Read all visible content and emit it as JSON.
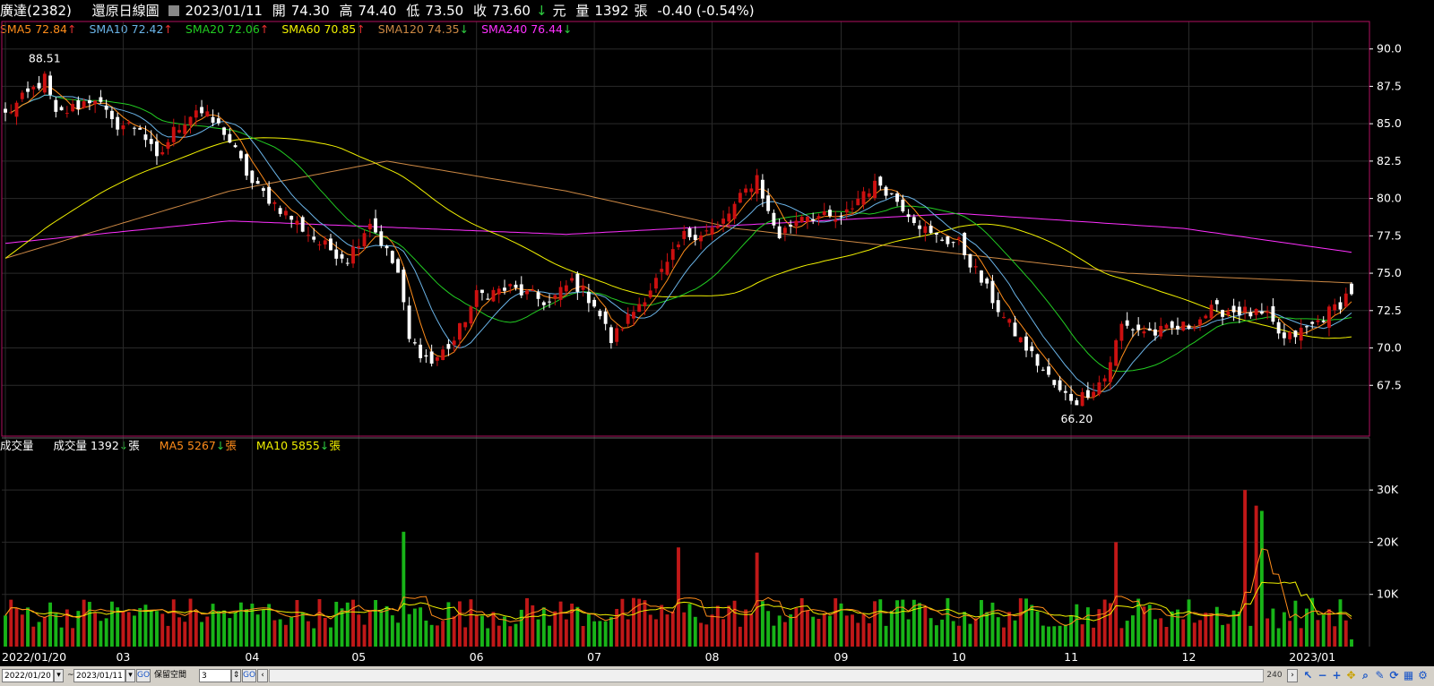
{
  "header": {
    "stock_name": "廣達(2382)",
    "mode": "還原日線圖",
    "date": "2023/01/11",
    "open_label": "開",
    "open": "74.30",
    "high_label": "高",
    "high": "74.40",
    "low_label": "低",
    "low": "73.50",
    "close_label": "收",
    "close": "73.60",
    "currency": "元",
    "volume_label": "量",
    "volume": "1392",
    "volume_unit": "張",
    "change": "-0.40 (-0.54%)"
  },
  "ma_legend": [
    {
      "label": "SMA5 72.84",
      "color": "#ff8c1a",
      "arrow": "↑"
    },
    {
      "label": "SMA10 72.42",
      "color": "#6ab4e8",
      "arrow": "↑"
    },
    {
      "label": "SMA20 72.06",
      "color": "#22cc22",
      "arrow": "↑"
    },
    {
      "label": "SMA60 70.85",
      "color": "#f0f000",
      "arrow": "↑"
    },
    {
      "label": "SMA120 74.35",
      "color": "#cc8844",
      "arrow": "↓"
    },
    {
      "label": "SMA240 76.44",
      "color": "#ff30ff",
      "arrow": "↓"
    }
  ],
  "volume_legend": {
    "title": "成交量",
    "vol": "成交量 1392",
    "vol_unit": "張",
    "vol_arrow": "↓",
    "ma5": "MA5 5267",
    "ma5_unit": "張",
    "ma5_arrow": "↓",
    "ma10": "MA10 5855",
    "ma10_unit": "張",
    "ma10_arrow": "↓"
  },
  "footer": {
    "start_date": "2022/01/20",
    "tilde": "~",
    "end_date": "2023/01/11",
    "go_label": "GO",
    "reserve_label": "保留空間",
    "reserve_value": "3",
    "zoom_value": "240"
  },
  "colors": {
    "up": "#cc1010",
    "down": "#ffffff",
    "vol_up": "#c01818",
    "vol_down": "#18b418",
    "grid": "#2a2a2a",
    "frame": "#b01060",
    "axis_text": "#ffffff"
  },
  "chart_data": {
    "type": "candlestick",
    "price_axis": {
      "ylim": [
        65.0,
        91.0
      ],
      "ticks": [
        67.5,
        70.0,
        72.5,
        75.0,
        77.5,
        80.0,
        82.5,
        85.0,
        87.5,
        90.0
      ]
    },
    "volume_axis": {
      "ylim": [
        0,
        35000
      ],
      "ticks": [
        10000,
        20000,
        30000
      ],
      "tick_labels": [
        "10K",
        "20K",
        "30K"
      ]
    },
    "x_ticks": [
      {
        "label": "2022/01/20",
        "i": 0
      },
      {
        "label": "03",
        "i": 21
      },
      {
        "label": "04",
        "i": 44
      },
      {
        "label": "05",
        "i": 63
      },
      {
        "label": "06",
        "i": 84
      },
      {
        "label": "07",
        "i": 105
      },
      {
        "label": "08",
        "i": 126
      },
      {
        "label": "09",
        "i": 149
      },
      {
        "label": "10",
        "i": 170
      },
      {
        "label": "11",
        "i": 190
      },
      {
        "label": "12",
        "i": 211
      },
      {
        "label": "2023/01",
        "i": 233
      }
    ],
    "annotations": [
      {
        "label": "88.51",
        "i": 7,
        "value": 88.51
      },
      {
        "label": "66.20",
        "i": 191,
        "value": 66.2
      }
    ],
    "anchors": [
      [
        0,
        85.6
      ],
      [
        7,
        88.0
      ],
      [
        9,
        85.5
      ],
      [
        16,
        86.8
      ],
      [
        19,
        85.0
      ],
      [
        24,
        84.8
      ],
      [
        27,
        82.5
      ],
      [
        30,
        84.5
      ],
      [
        34,
        86.0
      ],
      [
        39,
        84.5
      ],
      [
        44,
        81.0
      ],
      [
        50,
        79.0
      ],
      [
        56,
        77.0
      ],
      [
        61,
        76.0
      ],
      [
        65,
        78.5
      ],
      [
        70,
        75.0
      ],
      [
        72,
        70.5
      ],
      [
        76,
        69.0
      ],
      [
        80,
        70.5
      ],
      [
        84,
        73.5
      ],
      [
        90,
        74.0
      ],
      [
        97,
        73.0
      ],
      [
        101,
        74.5
      ],
      [
        105,
        73.0
      ],
      [
        108,
        70.5
      ],
      [
        112,
        72.5
      ],
      [
        118,
        75.5
      ],
      [
        121,
        77.5
      ],
      [
        127,
        78.0
      ],
      [
        131,
        80.0
      ],
      [
        134,
        81.5
      ],
      [
        136,
        79.0
      ],
      [
        138,
        77.5
      ],
      [
        142,
        79.0
      ],
      [
        149,
        78.5
      ],
      [
        153,
        80.5
      ],
      [
        156,
        81.0
      ],
      [
        160,
        79.5
      ],
      [
        165,
        77.5
      ],
      [
        170,
        77.0
      ],
      [
        174,
        74.5
      ],
      [
        178,
        72.0
      ],
      [
        183,
        69.5
      ],
      [
        188,
        67.0
      ],
      [
        191,
        66.5
      ],
      [
        196,
        68.0
      ],
      [
        199,
        71.5
      ],
      [
        205,
        71.0
      ],
      [
        211,
        71.5
      ],
      [
        215,
        72.5
      ],
      [
        220,
        72.5
      ],
      [
        225,
        72.0
      ],
      [
        228,
        70.5
      ],
      [
        233,
        71.5
      ],
      [
        238,
        73.0
      ],
      [
        240,
        74.0
      ]
    ],
    "ma_end_values": {
      "SMA5": 72.84,
      "SMA10": 72.42,
      "SMA20": 72.06,
      "SMA60": 70.85,
      "SMA120": 74.35,
      "SMA240": 76.44
    },
    "sma240_anchors": [
      [
        0,
        77.0
      ],
      [
        40,
        78.5
      ],
      [
        100,
        77.6
      ],
      [
        170,
        79.0
      ],
      [
        210,
        78.0
      ],
      [
        240,
        76.4
      ]
    ],
    "sma120_anchors": [
      [
        0,
        76.0
      ],
      [
        40,
        80.5
      ],
      [
        68,
        82.5
      ],
      [
        100,
        80.5
      ],
      [
        130,
        78.0
      ],
      [
        170,
        76.3
      ],
      [
        200,
        75.0
      ],
      [
        240,
        74.35
      ]
    ],
    "volume_spikes": [
      [
        71,
        22000
      ],
      [
        120,
        19000
      ],
      [
        134,
        18000
      ],
      [
        198,
        20000
      ],
      [
        221,
        30000
      ],
      [
        223,
        27000
      ],
      [
        224,
        26000
      ]
    ],
    "last_close": 73.6,
    "last_volume": 1392
  }
}
